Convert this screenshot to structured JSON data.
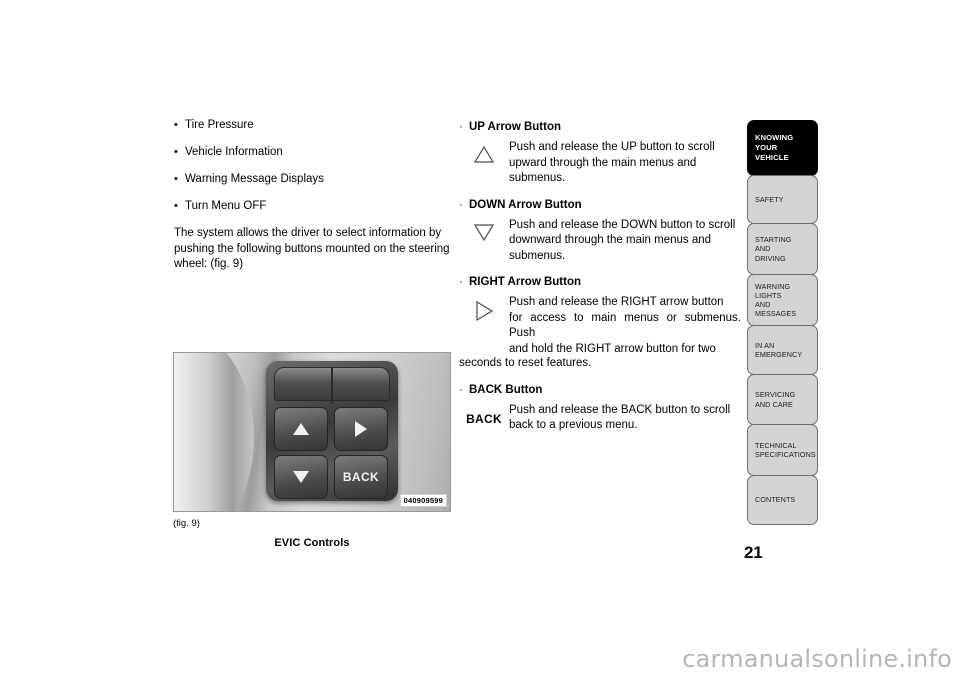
{
  "left_column": {
    "bullets": [
      "Tire Pressure",
      "Vehicle Information",
      "Warning Message Displays",
      "Turn Menu OFF"
    ],
    "bullet_marker": "•",
    "paragraph_line1": "The system allows the driver to select information by",
    "paragraph_line2": "pushing the following buttons mounted on the steering",
    "paragraph_line3": "wheel:  (fig. 9)"
  },
  "figure": {
    "fig_number": "(fig. 9)",
    "caption": "EVIC Controls",
    "image_code": "040909599",
    "back_button_label": "BACK",
    "up_arrow_icon": "triangle-up-icon",
    "down_arrow_icon": "triangle-down-icon",
    "right_arrow_icon": "triangle-right-icon"
  },
  "right_column": {
    "bullet_marker": "·",
    "sections": [
      {
        "heading": "UP Arrow Button",
        "glyph": "△",
        "glyph_name": "up-arrow-outline-icon",
        "line1": "Push and release the UP button to scroll",
        "line2": "upward through the main menus and",
        "line3": "submenus.",
        "overflow": ""
      },
      {
        "heading": "DOWN Arrow Button",
        "glyph": "▽",
        "glyph_name": "down-arrow-outline-icon",
        "line1": "Push and release the DOWN button to scroll",
        "line2": "downward through the main menus and",
        "line3": "submenus.",
        "overflow": ""
      },
      {
        "heading": "RIGHT Arrow Button",
        "glyph": "▷",
        "glyph_name": "right-arrow-outline-icon",
        "line1": "Push and release the RIGHT arrow button",
        "line2": "for access to main menus or submenus. Push",
        "line3": "and hold the RIGHT arrow button for two",
        "overflow": "seconds to reset features."
      },
      {
        "heading": "BACK Button",
        "glyph": "BACK",
        "glyph_name": "back-text-icon",
        "line1": "Push and release the BACK button to scroll",
        "line2": "back to a previous menu.",
        "line3": "",
        "overflow": ""
      }
    ]
  },
  "side_tabs": {
    "items": [
      {
        "label": "KNOWING\nYOUR\nVEHICLE",
        "active": true
      },
      {
        "label": "SAFETY",
        "active": false
      },
      {
        "label": "STARTING\nAND\nDRIVING",
        "active": false
      },
      {
        "label": "WARNING\nLIGHTS\nAND\nMESSAGES",
        "active": false
      },
      {
        "label": "IN AN\nEMERGENCY",
        "active": false
      },
      {
        "label": "SERVICING\nAND CARE",
        "active": false
      },
      {
        "label": "TECHNICAL\nSPECIFICATIONS",
        "active": false
      },
      {
        "label": "CONTENTS",
        "active": false
      }
    ],
    "active_bg": "#000000",
    "inactive_bg": "#d4d4d4"
  },
  "page_number": "21",
  "watermark": "carmanualsonline.info"
}
